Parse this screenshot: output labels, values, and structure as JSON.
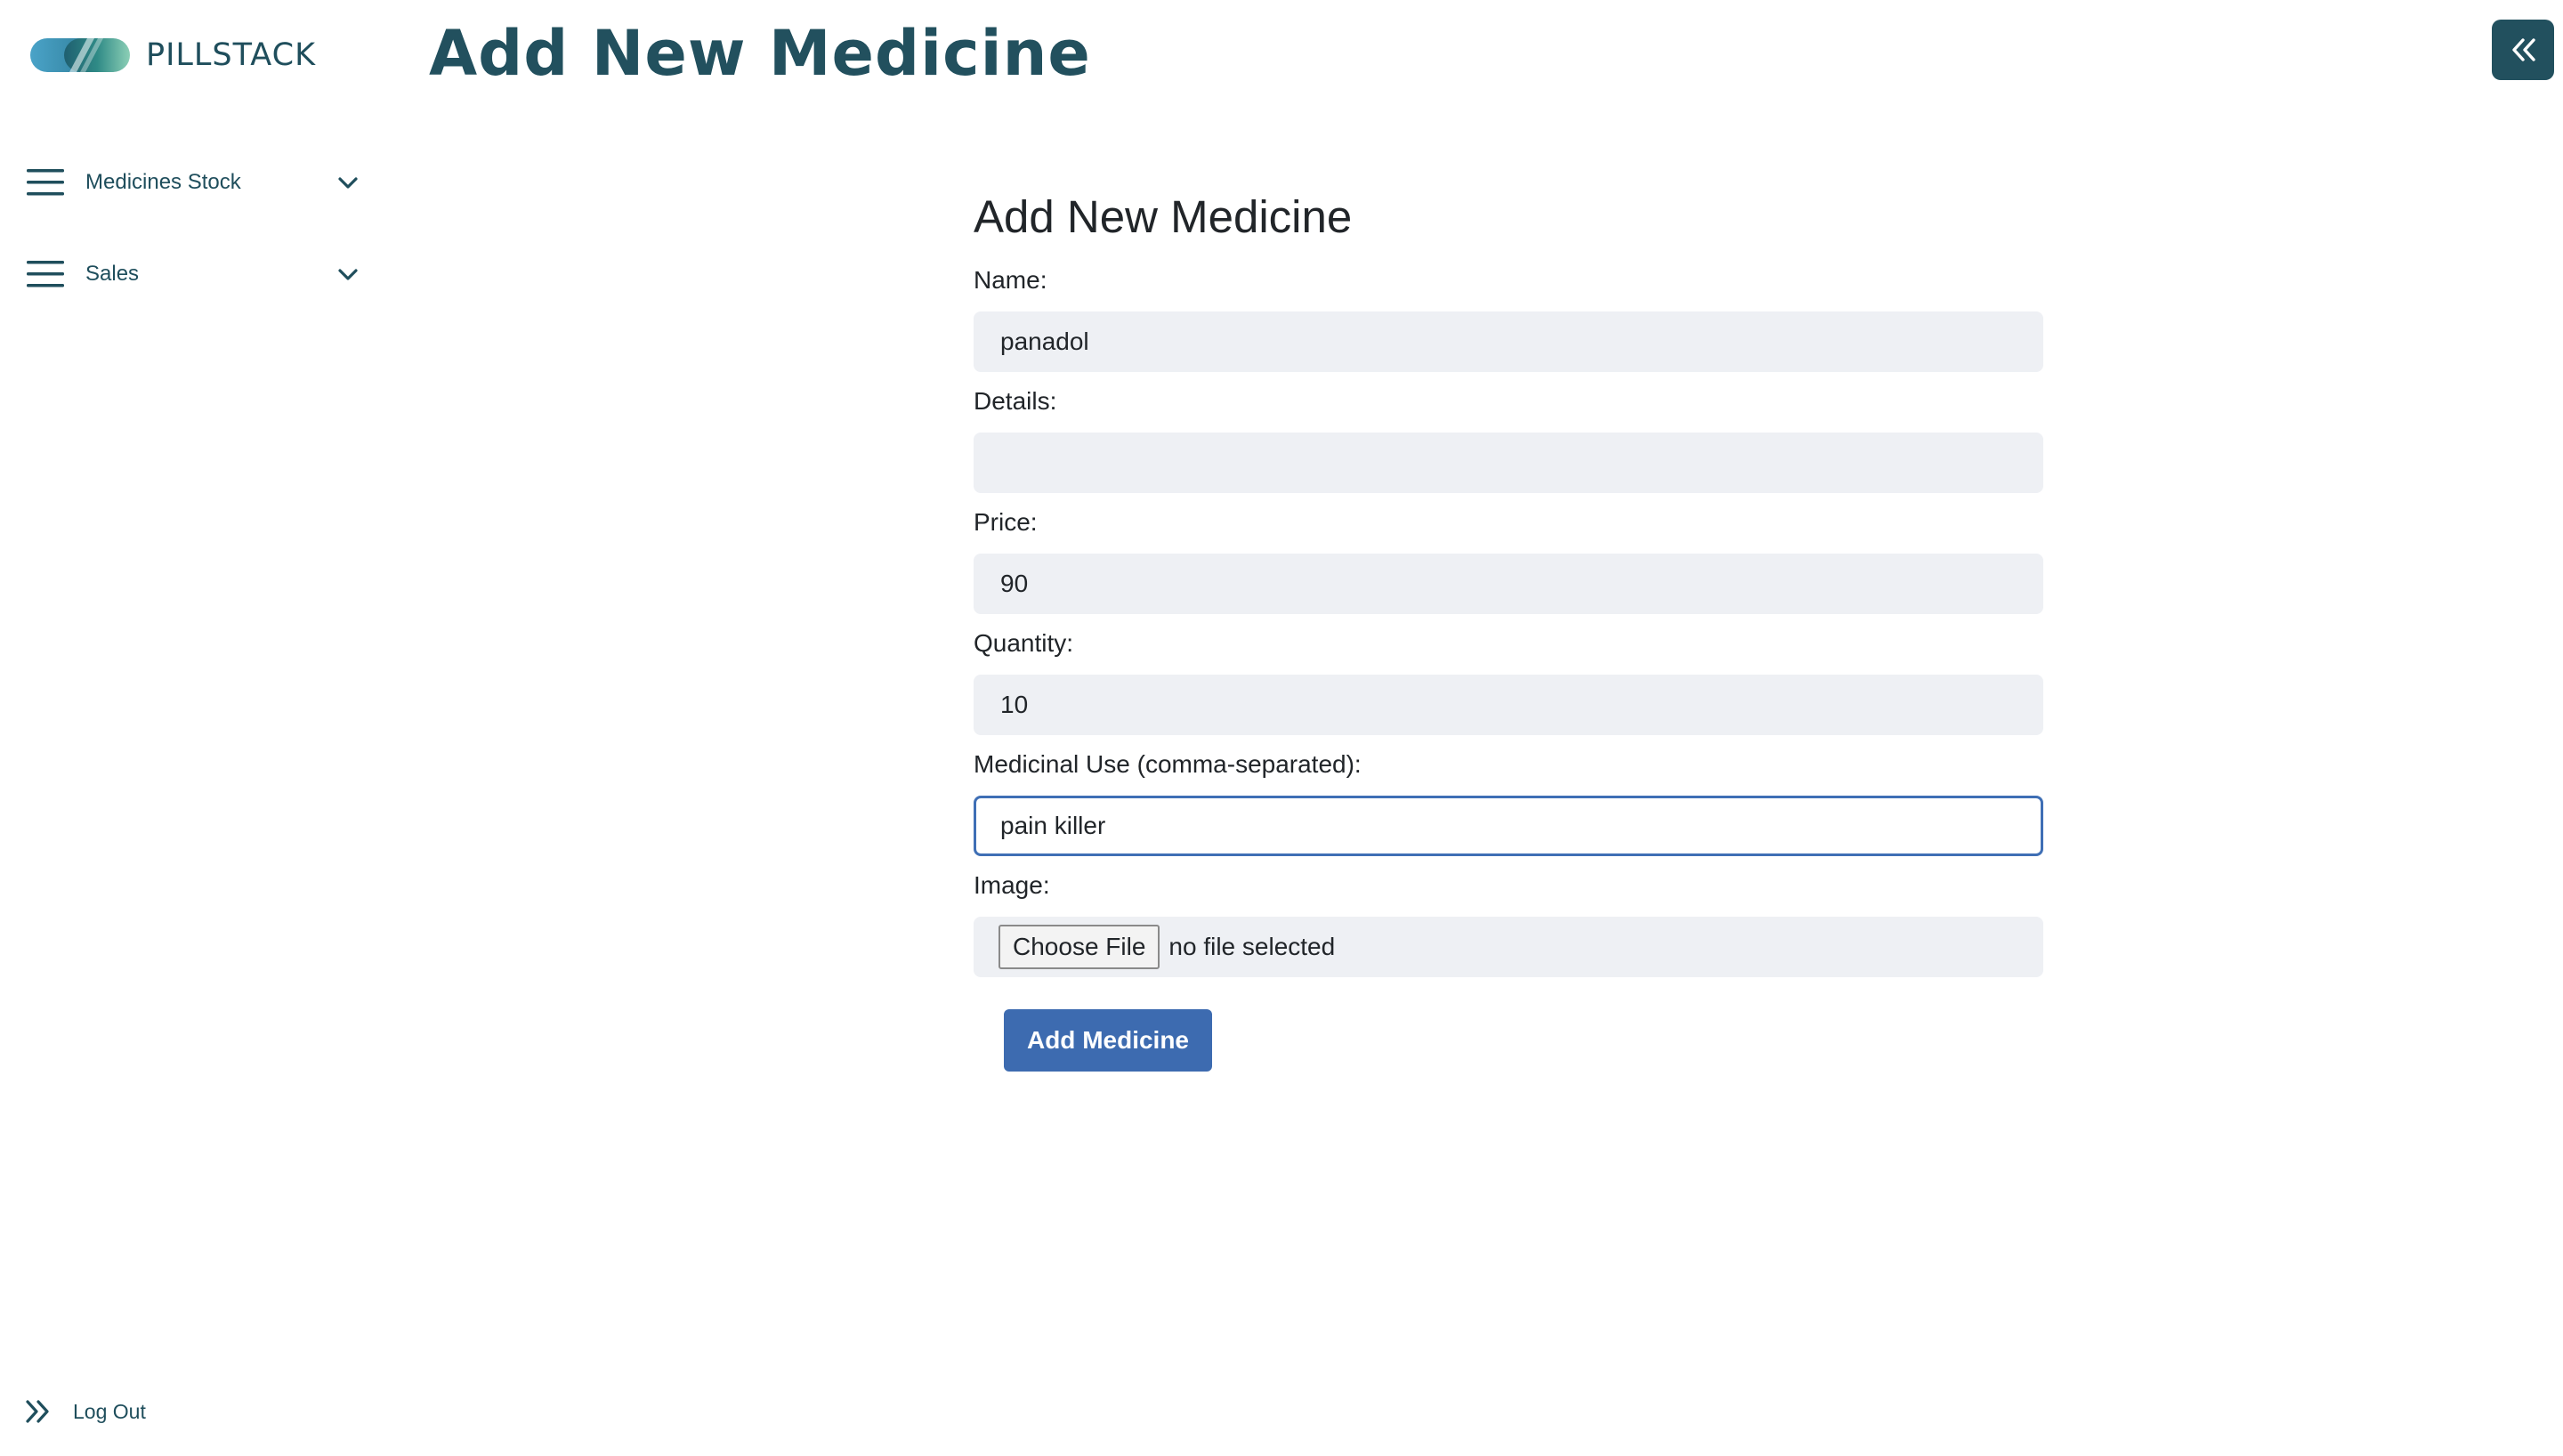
{
  "brand": {
    "name": "PILLSTACK",
    "logo_icon": "pill-capsule-logo"
  },
  "sidebar": {
    "items": [
      {
        "label": "Medicines Stock",
        "icon": "menu-icon",
        "expand_icon": "chevron-down-icon"
      },
      {
        "label": "Sales",
        "icon": "menu-icon",
        "expand_icon": "chevron-down-icon"
      }
    ],
    "logout": {
      "label": "Log Out",
      "icon": "double-chevron-right-icon"
    }
  },
  "header": {
    "title": "Add New Medicine",
    "collapse_icon": "double-chevron-left-icon"
  },
  "form": {
    "heading": "Add New Medicine",
    "fields": {
      "name": {
        "label": "Name:",
        "value": "panadol"
      },
      "details": {
        "label": "Details:",
        "value": ""
      },
      "price": {
        "label": "Price:",
        "value": "90"
      },
      "quantity": {
        "label": "Quantity:",
        "value": "10"
      },
      "medicinal_use": {
        "label": "Medicinal Use (comma-separated):",
        "value": "pain killer"
      },
      "image": {
        "label": "Image:",
        "button_label": "Choose File",
        "status": "no file selected"
      }
    },
    "submit_label": "Add Medicine"
  },
  "colors": {
    "brand_dark": "#22505e",
    "accent_blue": "#3d6bb0",
    "input_bg": "#eef0f4"
  }
}
